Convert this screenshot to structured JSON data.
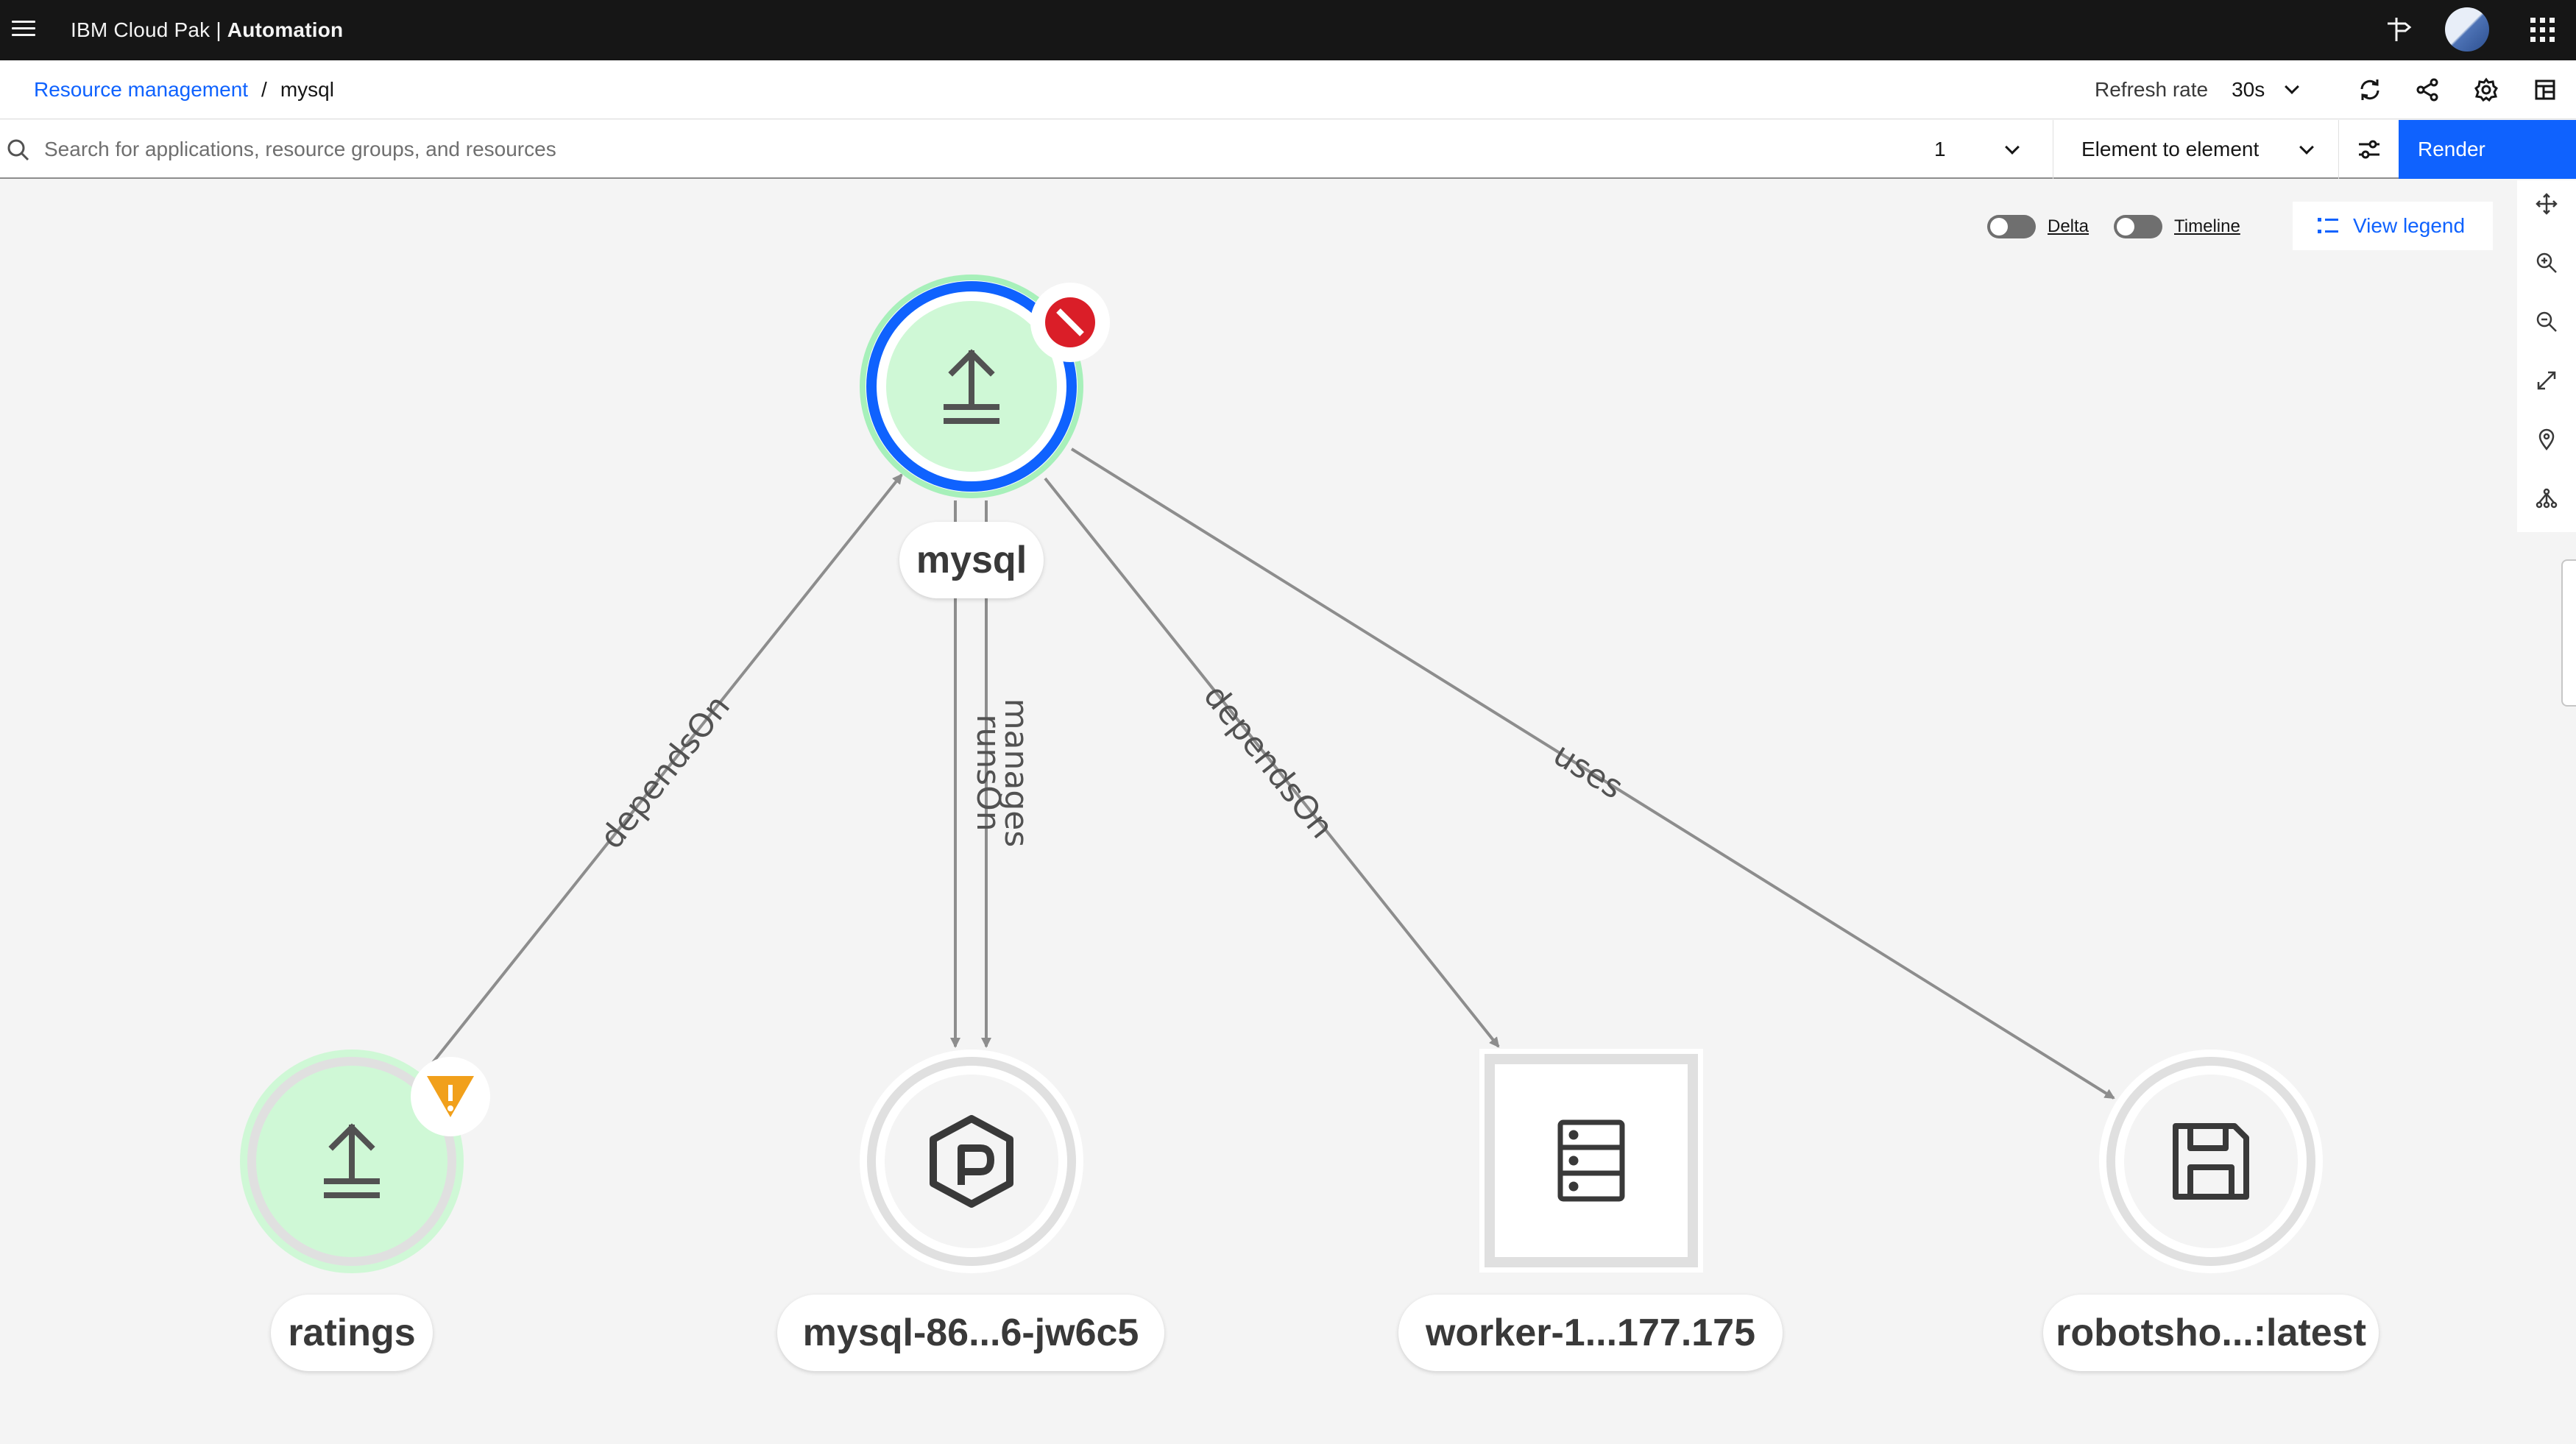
{
  "header": {
    "brand_prefix": "IBM Cloud Pak | ",
    "brand_product": "Automation"
  },
  "breadcrumb": {
    "parent": "Resource management",
    "separator": "/",
    "current": "mysql"
  },
  "refresh": {
    "label": "Refresh rate",
    "value": "30s"
  },
  "search": {
    "placeholder": "Search for applications, resource groups, and resources",
    "hops_value": "1",
    "hop_type": "Element to element",
    "render_label": "Render"
  },
  "canvas_controls": {
    "delta_label": "Delta",
    "timeline_label": "Timeline",
    "legend_label": "View legend"
  },
  "topology": {
    "nodes": {
      "center": {
        "label": "mysql",
        "status": "critical",
        "icon": "upload-icon"
      },
      "ratings": {
        "label": "ratings",
        "status": "warning",
        "icon": "upload-icon"
      },
      "pod": {
        "label": "mysql-86...6-jw6c5",
        "icon": "pod-icon"
      },
      "worker": {
        "label": "worker-1...177.175",
        "icon": "server-icon"
      },
      "image": {
        "label": "robotsho...:latest",
        "icon": "save-icon"
      }
    },
    "edges": {
      "ratings_depends": "dependsOn",
      "pod_runs": "runsOn",
      "pod_manages": "manages",
      "worker_depends": "dependsOn",
      "image_uses": "uses"
    }
  },
  "colors": {
    "header_bg": "#161616",
    "accent": "#0f62fe",
    "node_fill_green": "#cff8d6",
    "critical": "#da1e28",
    "warning": "#f1c21b"
  }
}
